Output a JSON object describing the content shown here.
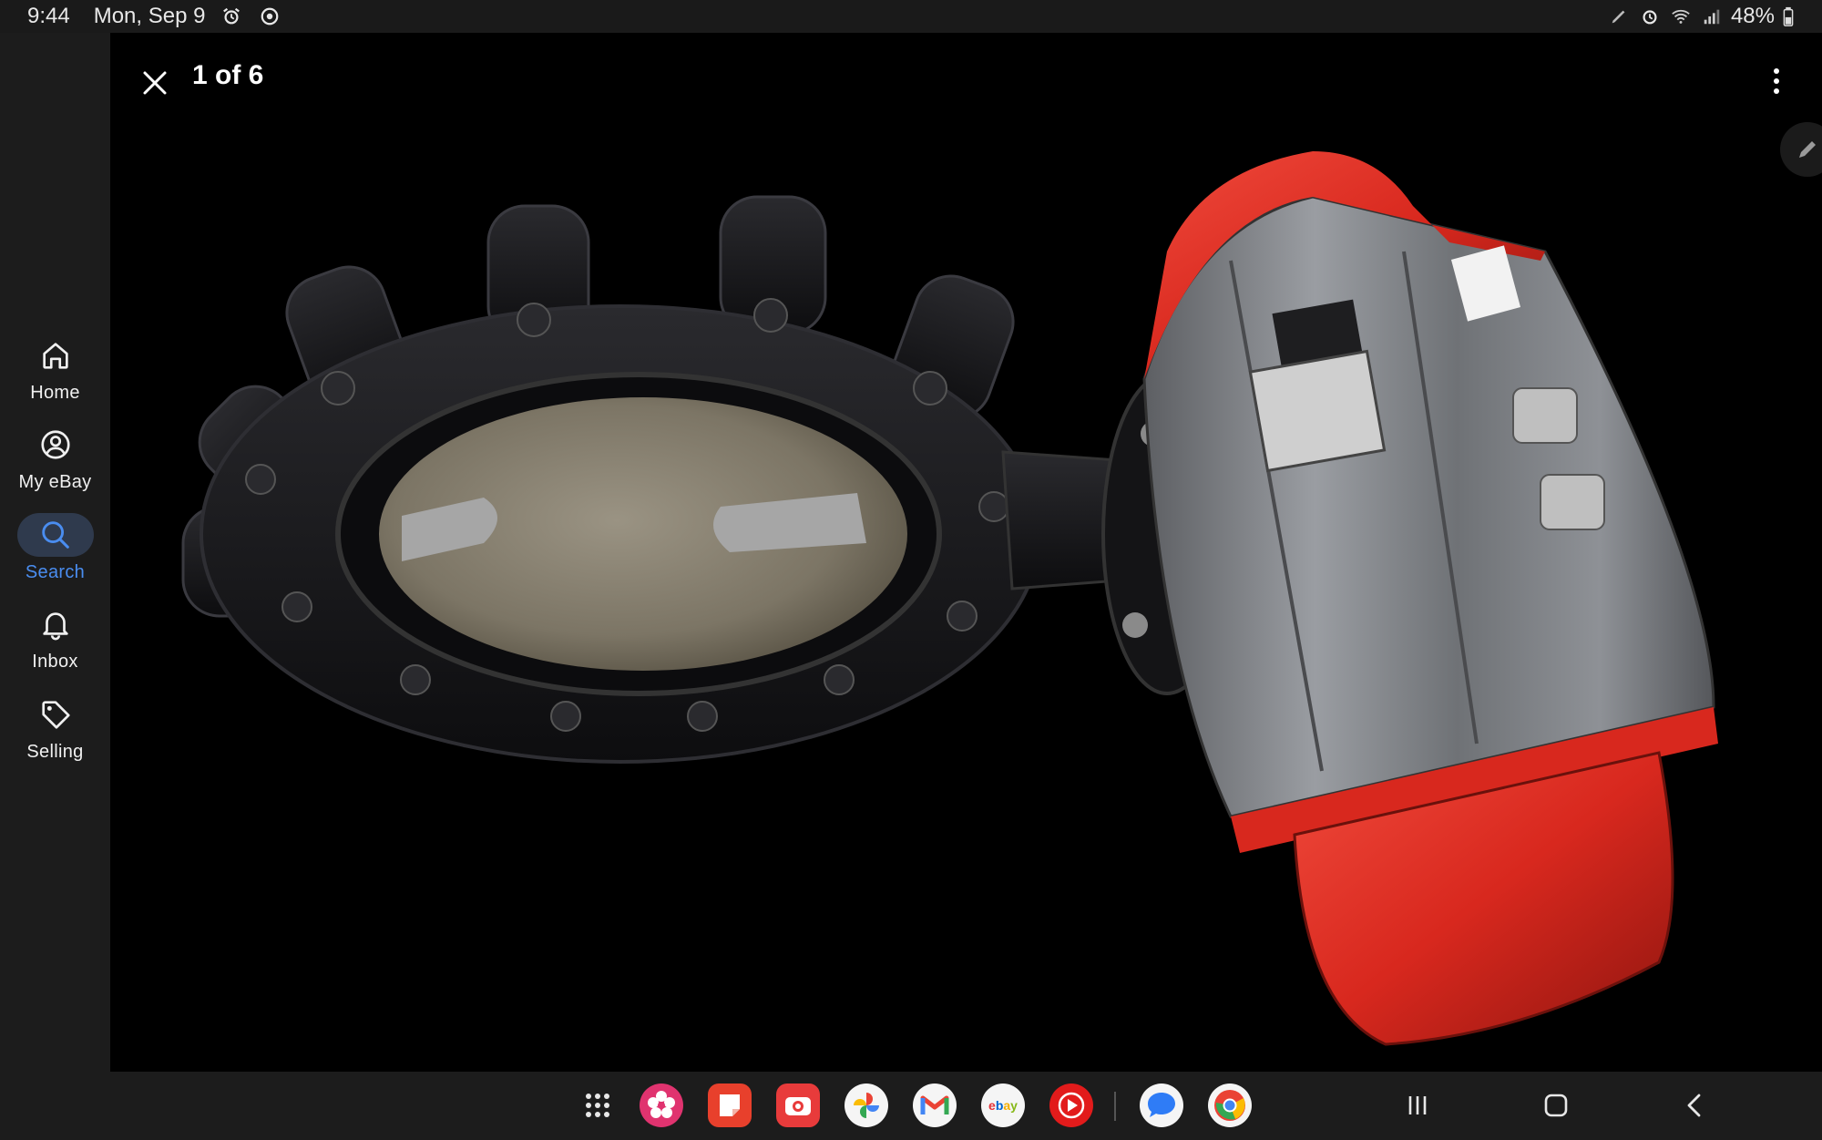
{
  "status_bar": {
    "time": "9:44",
    "date": "Mon, Sep 9",
    "battery": "48%"
  },
  "nav": {
    "items": [
      {
        "label": "Home",
        "icon": "home-icon"
      },
      {
        "label": "My eBay",
        "icon": "account-icon"
      },
      {
        "label": "Search",
        "icon": "search-icon",
        "active": true
      },
      {
        "label": "Inbox",
        "icon": "bell-icon"
      },
      {
        "label": "Selling",
        "icon": "tag-icon"
      }
    ],
    "active_color": "#4a8df0"
  },
  "viewer": {
    "counter": "1 of 6",
    "photo_subject": "butterfly valve with red pneumatic actuator"
  },
  "taskbar": {
    "apps": [
      {
        "name": "apps-grid",
        "icon": "apps-grid-icon"
      },
      {
        "name": "blossom",
        "icon": "flower-app-icon",
        "color": "#e0336f"
      },
      {
        "name": "notes",
        "icon": "notes-app-icon",
        "color": "#e8402c"
      },
      {
        "name": "camera",
        "icon": "camera-app-icon",
        "color": "#e83b3b"
      },
      {
        "name": "photos",
        "icon": "photos-app-icon"
      },
      {
        "name": "gmail",
        "icon": "gmail-app-icon"
      },
      {
        "name": "ebay",
        "icon": "ebay-app-icon",
        "label": "ebay"
      },
      {
        "name": "youtube-music",
        "icon": "youtube-music-app-icon",
        "color": "#e21b1b"
      },
      {
        "name": "messages",
        "icon": "messages-app-icon",
        "color": "#2f7cf6"
      },
      {
        "name": "chrome",
        "icon": "chrome-app-icon"
      }
    ]
  },
  "colors": {
    "background": "#000000",
    "chrome_bg": "#1c1c1c",
    "actuator_red": "#d8281e",
    "valve_black": "#151517"
  }
}
